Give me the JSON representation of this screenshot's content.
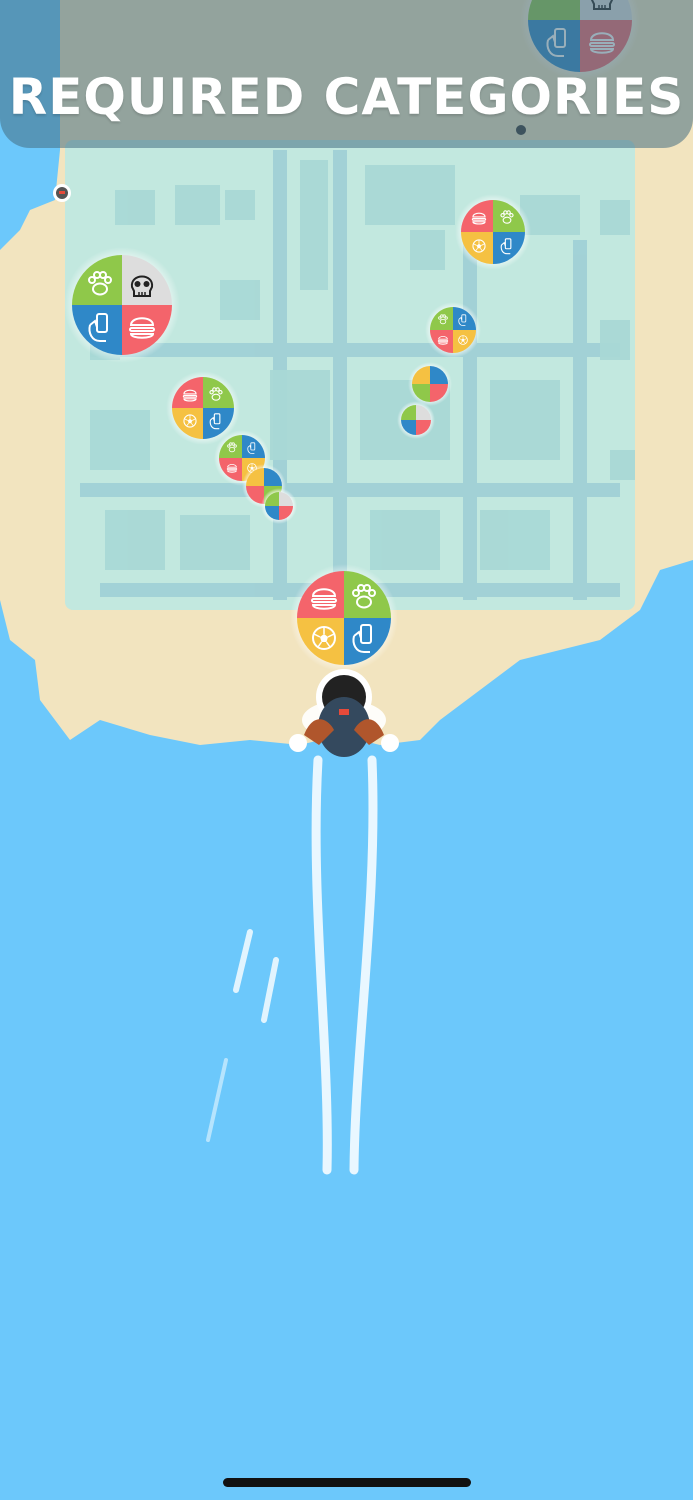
{
  "banner": {
    "title": "REQUIRED CATEGORIES"
  },
  "colors": {
    "water": "#6cc8fb",
    "sand": "#f2e4bf",
    "city": "#bfe8e0",
    "banner_overlay": "#466e82",
    "category_green": "#8fc84a",
    "category_red": "#f4646b",
    "category_blue": "#2f88c8",
    "category_yellow": "#f5c142",
    "category_gray": "#dddddd"
  },
  "category_icons": [
    "paw-icon",
    "skull-icon",
    "hand-phone-icon",
    "burger-icon",
    "soccer-ball-icon"
  ],
  "player": {
    "name": "parachute-jumper",
    "trail": "white-smoke"
  }
}
